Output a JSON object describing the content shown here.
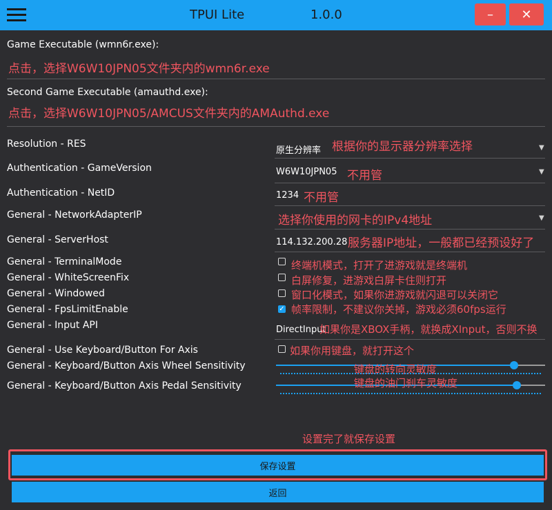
{
  "titlebar": {
    "title": "TPUI Lite",
    "version": "1.0.0",
    "minimize": "–",
    "close": "✕"
  },
  "game_exe": {
    "label": "Game Executable (wmn6r.exe):",
    "hint": "点击，选择W6W10JPN05文件夹内的wmn6r.exe"
  },
  "second_exe": {
    "label": "Second Game Executable (amauthd.exe):",
    "hint": "点击，选择W6W10JPN05/AMCUS文件夹内的AMAuthd.exe"
  },
  "settings": {
    "resolution": {
      "label": "Resolution - RES",
      "value": "原生分辨率",
      "hint": "根据你的显示器分辨率选择"
    },
    "game_version": {
      "label": "Authentication - GameVersion",
      "value": "W6W10JPN05",
      "hint": "不用管"
    },
    "net_id": {
      "label": "Authentication - NetID",
      "value": "1234",
      "hint": "不用管"
    },
    "network_adapter": {
      "label": "General - NetworkAdapterIP",
      "value": "",
      "hint": "选择你使用的网卡的IPv4地址"
    },
    "server_host": {
      "label": "General - ServerHost",
      "value": "114.132.200.28",
      "hint": "服务器IP地址，一般都已经预设好了"
    },
    "terminal_mode": {
      "label": "General - TerminalMode",
      "hint": "终端机模式，打开了进游戏就是终端机",
      "checked": false
    },
    "white_screen_fix": {
      "label": "General - WhiteScreenFix",
      "hint": "白屏修复，进游戏白屏卡住则打开",
      "checked": false
    },
    "windowed": {
      "label": "General - Windowed",
      "hint": "窗口化模式，如果你进游戏就闪退可以关闭它",
      "checked": false
    },
    "fps_limit": {
      "label": "General - FpsLimitEnable",
      "hint": "帧率限制，不建议你关掉，游戏必须60fps运行",
      "checked": true
    },
    "input_api": {
      "label": "General - Input API",
      "value": "DirectInput",
      "hint": "如果你是XBOX手柄，就换成XInput，否则不换"
    },
    "use_keyboard": {
      "label": "General - Use Keyboard/Button For Axis",
      "hint": "如果你用键盘，就打开这个",
      "checked": false
    },
    "wheel_sensitivity": {
      "label": "General - Keyboard/Button Axis Wheel Sensitivity",
      "hint": "键盘的转向灵敏度",
      "level": 0.87
    },
    "pedal_sensitivity": {
      "label": "General - Keyboard/Button Axis Pedal Sensitivity",
      "hint": "键盘的油门刹车灵敏度",
      "level": 0.89
    }
  },
  "footer": {
    "hint": "设置完了就保存设置",
    "save": "保存设置",
    "back": "返回"
  },
  "icons": {
    "menu": "hamburger-menu-icon",
    "dropdown": "chevron-down-icon",
    "check": "checkmark-icon"
  },
  "colors": {
    "accent": "#1ba1f2",
    "hint": "#f0555f",
    "background": "#2d2d30",
    "window_button": "#e9524f"
  }
}
